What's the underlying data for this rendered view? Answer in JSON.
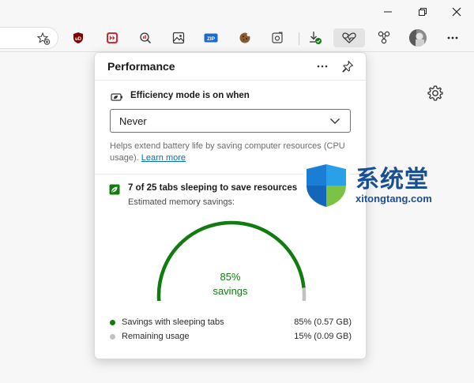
{
  "window": {
    "minimize_label": "—",
    "restore_label": "❐",
    "close_label": "✕"
  },
  "toolbar": {
    "icons": [
      {
        "name": "favorite-add-icon",
        "glyph": "☆"
      },
      {
        "name": "ublock-icon",
        "glyph": "uD"
      },
      {
        "name": "video-ext-icon",
        "glyph": "▶"
      },
      {
        "name": "search-ext-icon",
        "glyph": "⌕"
      },
      {
        "name": "image-ext-icon",
        "glyph": "▣"
      },
      {
        "name": "zip-ext-icon",
        "glyph": "ZIP"
      },
      {
        "name": "cookie-icon",
        "glyph": "●"
      },
      {
        "name": "screenshot-ext-icon",
        "glyph": "◎"
      },
      {
        "name": "downloads-icon",
        "glyph": "↓"
      },
      {
        "name": "performance-icon",
        "glyph": "♡"
      },
      {
        "name": "extensions-icon",
        "glyph": "⚇"
      },
      {
        "name": "profile-avatar",
        "glyph": ""
      },
      {
        "name": "more-menu-icon",
        "glyph": "···"
      }
    ]
  },
  "panel": {
    "title": "Performance",
    "more_label": "···",
    "efficiency_label": "Efficiency mode is on when",
    "select_value": "Never",
    "help_text": "Helps extend battery life by saving computer resources (CPU usage).",
    "learn_more": "Learn more",
    "sleeping_text": "7 of 25 tabs sleeping to save resources",
    "memory_label": "Estimated memory savings:",
    "savings_pct": "85%",
    "savings_word": "savings",
    "legend": [
      {
        "label": "Savings with sleeping tabs",
        "value": "85% (0.57 GB)",
        "color": "#107c10"
      },
      {
        "label": "Remaining usage",
        "value": "15% (0.09 GB)",
        "color": "#c2c2c2"
      }
    ],
    "savings_fraction": 0.85,
    "colors": {
      "savings": "#107c10",
      "remaining": "#c2c2c2"
    }
  },
  "watermark": {
    "cn_text": "系统堂",
    "en_text": "xitongtang.com"
  }
}
